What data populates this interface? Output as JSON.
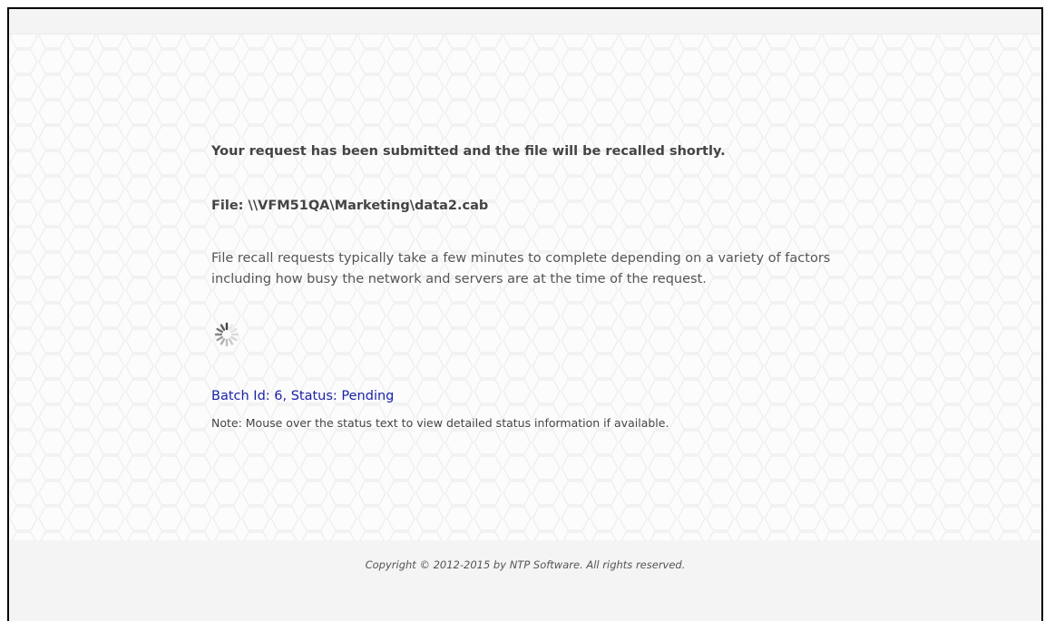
{
  "message": {
    "headline": "Your request has been submitted and the file will be recalled shortly.",
    "file_label": "File: \\\\VFM51QA\\Marketing\\data2.cab",
    "description": "File recall requests typically take a few minutes to complete depending on a variety of factors including how busy the network and servers are at the time of the request."
  },
  "status": {
    "spinner_icon": "loading-spinner-icon",
    "batch_status_text": "Batch Id: 6, Status: Pending",
    "link_color": "#1a22a6",
    "note": "Note: Mouse over the status text to view detailed status information if available."
  },
  "footer": {
    "copyright": "Copyright © 2012-2015 by NTP Software. All rights reserved."
  }
}
